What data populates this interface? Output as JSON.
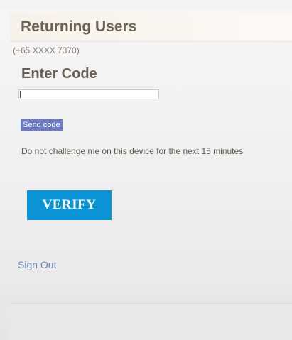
{
  "header": {
    "title": "Returning Users"
  },
  "phone": {
    "masked": "(+65 XXXX 7370)"
  },
  "code": {
    "label": "Enter Code",
    "value": ""
  },
  "send_code": {
    "label": "Send code"
  },
  "remember": {
    "text": "Do not challenge me on this device for the next 15 minutes"
  },
  "verify": {
    "label": "VERIFY"
  },
  "sign_out": {
    "label": "Sign Out"
  },
  "colors": {
    "accent_button": "#0c95d6",
    "send_code_bg": "#6a7cc8",
    "heading_text": "#6b6055",
    "link": "#6b86b7"
  }
}
